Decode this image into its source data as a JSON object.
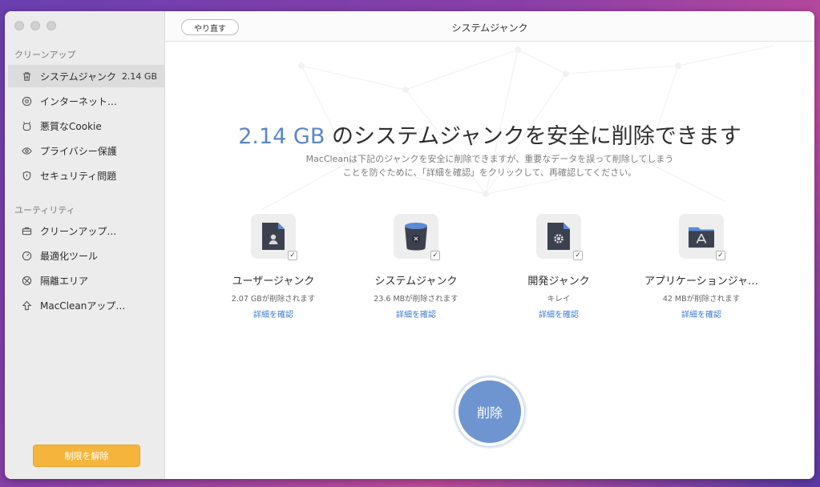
{
  "sidebar": {
    "sections": [
      {
        "title": "クリーンアップ",
        "items": [
          {
            "label": "システムジャンク",
            "size": "2.14 GB",
            "icon": "trash-icon"
          },
          {
            "label": "インターネット…",
            "icon": "compass-icon"
          },
          {
            "label": "悪質なCookie",
            "icon": "cookie-icon"
          },
          {
            "label": "プライバシー保護",
            "icon": "eye-icon"
          },
          {
            "label": "セキュリティ問題",
            "icon": "shield-icon"
          }
        ]
      },
      {
        "title": "ユーティリティ",
        "items": [
          {
            "label": "クリーンアップ…",
            "icon": "briefcase-icon"
          },
          {
            "label": "最適化ツール",
            "icon": "gauge-icon"
          },
          {
            "label": "隔離エリア",
            "icon": "quarantine-icon"
          },
          {
            "label": "MacCleanアップ…",
            "icon": "upgrade-icon"
          }
        ]
      }
    ],
    "unlock_button": "制限を解除"
  },
  "toolbar": {
    "redo_label": "やり直す",
    "title": "システムジャンク"
  },
  "main": {
    "headline_size": "2.14 GB",
    "headline_text": " のシステムジャンクを安全に削除できます",
    "description_line1": "MacCleanは下記のジャンクを安全に削除できますが、重要なデータを誤って削除してしまう",
    "description_line2": "ことを防ぐために、「詳細を確認」をクリックして、再確認してください。",
    "cards": [
      {
        "name": "ユーザージャンク",
        "sub": "2.07 GBが削除されます",
        "link": "詳細を確認",
        "icon": "user-file-icon",
        "checked": true
      },
      {
        "name": "システムジャンク",
        "sub": "23.6 MBが削除されます",
        "link": "詳細を確認",
        "icon": "bin-icon",
        "checked": true
      },
      {
        "name": "開発ジャンク",
        "sub": "キレイ",
        "link": "詳細を確認",
        "icon": "gear-file-icon",
        "checked": true
      },
      {
        "name": "アプリケーションジャ…",
        "sub": "42 MBが削除されます",
        "link": "詳細を確認",
        "icon": "app-folder-icon",
        "checked": true
      }
    ],
    "delete_button": "削除"
  },
  "colors": {
    "accent": "#5b87c5",
    "delete_button": "#6f95d0",
    "unlock_button": "#f5b53d",
    "link": "#3d7bd6"
  }
}
